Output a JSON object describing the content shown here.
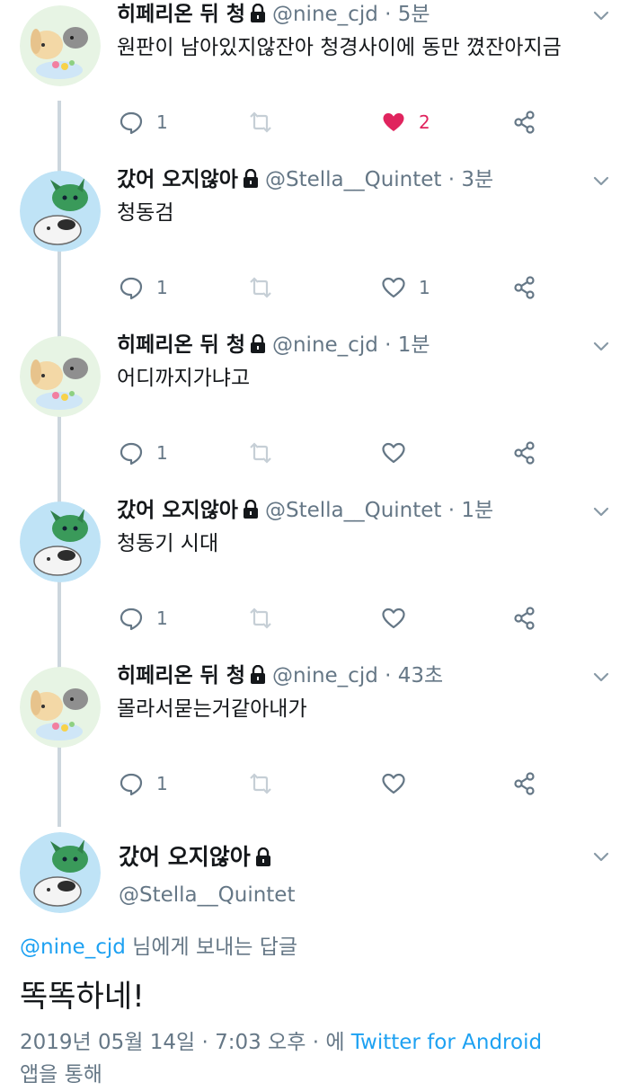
{
  "tweets": [
    {
      "avatar": "bunny-cat-avatar",
      "name": "히페리온 뒤 청",
      "handle": "@nine_cjd",
      "time": "· 5분",
      "text": "원판이 남아있지않잔아 청경사이에 동만 꼈잔아지금",
      "reply_count": "1",
      "like_count": "2",
      "liked": true
    },
    {
      "avatar": "green-dragon-cat-avatar",
      "name": "갔어 오지않아",
      "handle": "@Stella__Quintet",
      "time": "· 3분",
      "text": "청동검",
      "reply_count": "1",
      "like_count": "1",
      "liked": false
    },
    {
      "avatar": "bunny-cat-avatar",
      "name": "히페리온 뒤 청",
      "handle": "@nine_cjd",
      "time": "· 1분",
      "text": "어디까지가냐고",
      "reply_count": "1",
      "like_count": "",
      "liked": false
    },
    {
      "avatar": "green-dragon-cat-avatar",
      "name": "갔어 오지않아",
      "handle": "@Stella__Quintet",
      "time": "· 1분",
      "text": "청동기 시대",
      "reply_count": "1",
      "like_count": "",
      "liked": false
    },
    {
      "avatar": "bunny-cat-avatar",
      "name": "히페리온 뒤 청",
      "handle": "@nine_cjd",
      "time": "· 43초",
      "text": "몰라서묻는거같아내가",
      "reply_count": "1",
      "like_count": "",
      "liked": false
    }
  ],
  "main_tweet": {
    "avatar": "green-dragon-cat-avatar",
    "name": "갔어 오지않아",
    "handle": "@Stella__Quintet",
    "replying_mention": "@nine_cjd",
    "replying_suffix": " 님에게 보내는 답글",
    "text": "똑똑하네!",
    "timestamp": "2019년 05월 14일 · 7:03 오후 · 에 ",
    "source": "Twitter for Android",
    "source_suffix": "앱을 통해"
  },
  "colors": {
    "text": "#14171a",
    "secondary": "#657786",
    "link": "#1da1f2",
    "like": "#e0245e",
    "thread_line": "#ccd6dd"
  },
  "icons": {
    "reply": "reply-icon",
    "retweet": "retweet-icon",
    "like": "heart-icon",
    "share": "share-icon",
    "caret": "chevron-down-icon",
    "lock": "lock-icon"
  }
}
